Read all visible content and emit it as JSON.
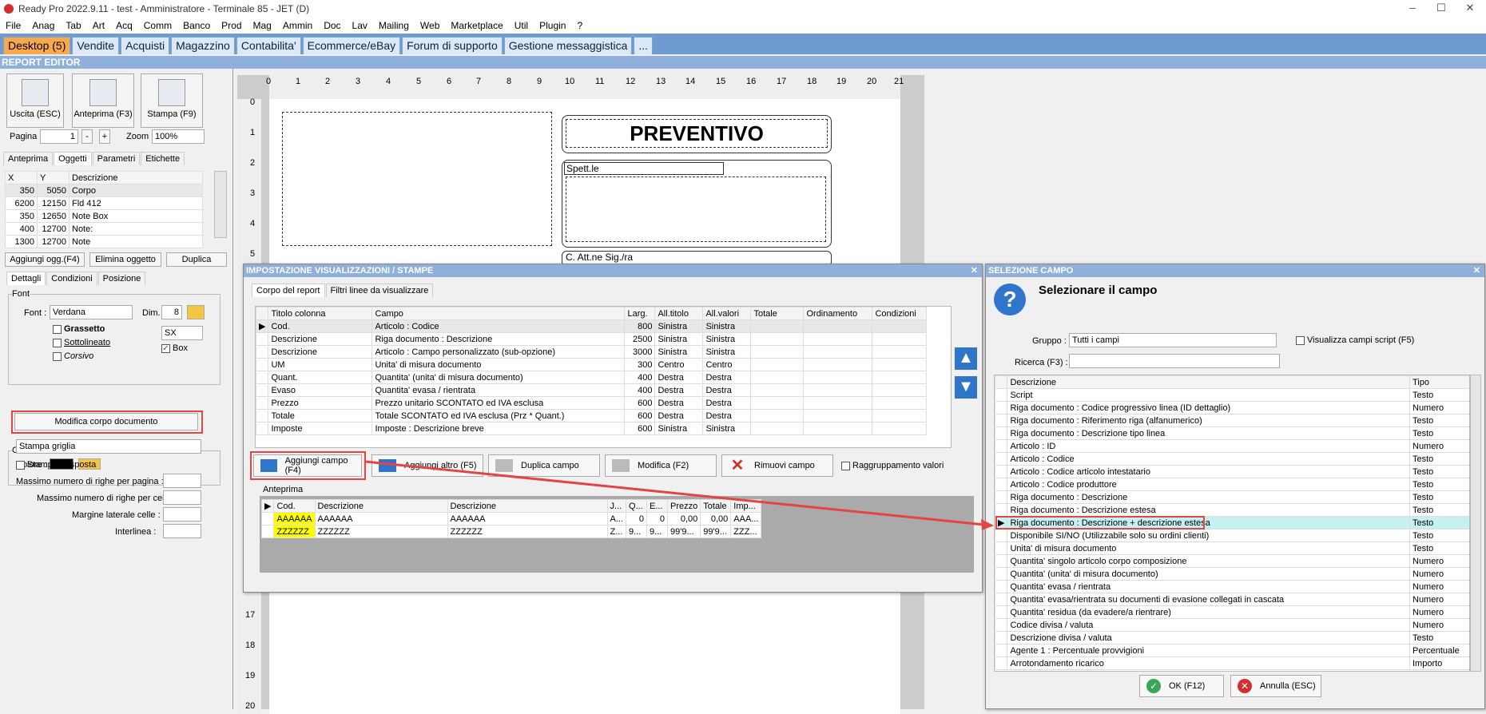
{
  "window": {
    "title": "Ready Pro 2022.9.11 - test - Amministratore - Terminale 85 - JET (D)",
    "min": "–",
    "max": "☐",
    "close": "✕"
  },
  "menu": [
    "File",
    "Anag",
    "Tab",
    "Art",
    "Acq",
    "Comm",
    "Banco",
    "Prod",
    "Mag",
    "Ammin",
    "Doc",
    "Lav",
    "Mailing",
    "Web",
    "Marketplace",
    "Util",
    "Plugin",
    "?"
  ],
  "tabs": [
    "Desktop (5)",
    "Vendite",
    "Acquisti",
    "Magazzino",
    "Contabilita'",
    "Ecommerce/eBay",
    "Forum di supporto",
    "Gestione messaggistica",
    "..."
  ],
  "section_title": "REPORT EDITOR",
  "toolbar": {
    "exit": "Uscita (ESC)",
    "preview": "Anteprima (F3)",
    "print": "Stampa (F9)"
  },
  "paging": {
    "page_label": "Pagina",
    "page_value": "1",
    "minus": "-",
    "plus": "+",
    "zoom_label": "Zoom",
    "zoom_value": "100%"
  },
  "left_tabs": [
    "Anteprima",
    "Oggetti",
    "Parametri",
    "Etichette"
  ],
  "objects_table": {
    "headers": [
      "X",
      "Y",
      "Descrizione"
    ],
    "rows": [
      [
        "350",
        "5050",
        "Corpo"
      ],
      [
        "6200",
        "12150",
        "Fld 412"
      ],
      [
        "350",
        "12650",
        "Note Box"
      ],
      [
        "400",
        "12700",
        "Note:"
      ],
      [
        "1300",
        "12700",
        "Note"
      ]
    ]
  },
  "object_buttons": {
    "add": "Aggiungi ogg.(F4)",
    "delete": "Elimina oggetto",
    "duplicate": "Duplica"
  },
  "detail_tabs": [
    "Dettagli",
    "Condizioni",
    "Posizione"
  ],
  "font_group": {
    "legend": "Font",
    "font_label": "Font :",
    "font_value": "Verdana",
    "dim_label": "Dim.",
    "dim_value": "8",
    "bold": "Grassetto",
    "underline": "Sottolineato",
    "italic": "Corsivo",
    "align_value": "SX",
    "box_label": "Box"
  },
  "color_group": {
    "legend": "Colore",
    "color_label": "Colore :",
    "color_value": "#000000"
  },
  "modify_body_button": "Modifica corpo documento",
  "grid_print": "Stampa griglia",
  "transposed": "Stampa trasposta",
  "max_rows_page": "Massimo numero di righe per pagina :",
  "max_rows_cell": "Massimo numero di righe per cella :",
  "side_margin": "Margine laterale celle :",
  "line_spacing": "Interlinea :",
  "ruler_numbers": [
    "0",
    "1",
    "2",
    "3",
    "4",
    "5",
    "6",
    "7",
    "8",
    "9",
    "10",
    "11",
    "12",
    "13",
    "14",
    "15",
    "16",
    "17",
    "18",
    "19",
    "20",
    "21"
  ],
  "ruler_left_top": [
    "0",
    "1",
    "2",
    "3",
    "4",
    "5"
  ],
  "ruler_left_bottom": [
    "17",
    "18",
    "19",
    "20"
  ],
  "page_content": {
    "title": "PREVENTIVO",
    "spett": "Spett.le",
    "att": "C. Att.ne Sig./ra"
  },
  "dialog1": {
    "title": "IMPOSTAZIONE VISUALIZZAZIONI / STAMPE",
    "tabs": [
      "Corpo del report",
      "Filtri linee da visualizzare"
    ],
    "headers": [
      "Titolo colonna",
      "Campo",
      "Larg.",
      "All.titolo",
      "All.valori",
      "Totale",
      "Ordinamento",
      "Condizioni"
    ],
    "rows": [
      [
        "Cod.",
        "Articolo : Codice",
        "800",
        "Sinistra",
        "Sinistra",
        "",
        "",
        ""
      ],
      [
        "Descrizione",
        "Riga documento : Descrizione",
        "2500",
        "Sinistra",
        "Sinistra",
        "",
        "",
        ""
      ],
      [
        "Descrizione",
        "Articolo : Campo personalizzato (sub-opzione)",
        "3000",
        "Sinistra",
        "Sinistra",
        "",
        "",
        ""
      ],
      [
        "UM",
        "Unita' di misura documento",
        "300",
        "Centro",
        "Centro",
        "",
        "",
        ""
      ],
      [
        "Quant.",
        "Quantita' (unita' di misura documento)",
        "400",
        "Destra",
        "Destra",
        "",
        "",
        ""
      ],
      [
        "Evaso",
        "Quantita' evasa / rientrata",
        "400",
        "Destra",
        "Destra",
        "",
        "",
        ""
      ],
      [
        "Prezzo",
        "Prezzo unitario SCONTATO ed IVA esclusa",
        "600",
        "Destra",
        "Destra",
        "",
        "",
        ""
      ],
      [
        "Totale",
        "Totale SCONTATO ed IVA esclusa (Prz * Quant.)",
        "600",
        "Destra",
        "Destra",
        "",
        "",
        ""
      ],
      [
        "Imposte",
        "Imposte : Descrizione breve",
        "600",
        "Sinistra",
        "Sinistra",
        "",
        "",
        ""
      ]
    ],
    "buttons": {
      "add_field": "Aggiungi campo (F4)",
      "add_other": "Aggiungi altro (F5)",
      "duplicate": "Duplica campo",
      "modify": "Modifica (F2)",
      "remove": "Rimuovi campo"
    },
    "group_values": "Raggruppamento valori",
    "preview_label": "Anteprima",
    "preview_headers": [
      "Cod.",
      "Descrizione",
      "Descrizione",
      "J...",
      "Q...",
      "E...",
      "Prezzo",
      "Totale",
      "Imp..."
    ],
    "preview_rows": [
      [
        "AAAAAA",
        "AAAAAA",
        "AAAAAA",
        "A...",
        "0",
        "0",
        "0,00",
        "0,00",
        "AAA..."
      ],
      [
        "ZZZZZZ",
        "ZZZZZZ",
        "ZZZZZZ",
        "Z...",
        "9...",
        "9...",
        "99'9...",
        "99'9...",
        "ZZZ..."
      ]
    ]
  },
  "dialog2": {
    "title": "SELEZIONE CAMPO",
    "heading": "Selezionare il campo",
    "group_label": "Gruppo :",
    "group_value": "Tutti i campi",
    "script_fields": "Visualizza campi script (F5)",
    "search_label": "Ricerca (F3) :",
    "search_value": "",
    "headers": [
      "Descrizione",
      "Tipo"
    ],
    "rows": [
      [
        "Script",
        "Testo"
      ],
      [
        "Riga documento : Codice progressivo linea (ID dettaglio)",
        "Numero"
      ],
      [
        "Riga documento : Riferimento riga (alfanumerico)",
        "Testo"
      ],
      [
        "Riga documento : Descrizione tipo linea",
        "Testo"
      ],
      [
        "Articolo : ID",
        "Numero"
      ],
      [
        "Articolo : Codice",
        "Testo"
      ],
      [
        "Articolo : Codice articolo intestatario",
        "Testo"
      ],
      [
        "Articolo : Codice produttore",
        "Testo"
      ],
      [
        "Riga documento : Descrizione",
        "Testo"
      ],
      [
        "Riga documento : Descrizione estesa",
        "Testo"
      ],
      [
        "Riga documento : Descrizione + descrizione estesa",
        "Testo"
      ],
      [
        "Disponibile SI/NO (Utilizzabile solo su ordini clienti)",
        "Testo"
      ],
      [
        "Unita' di misura documento",
        "Testo"
      ],
      [
        "Quantita' singolo articolo corpo composizione",
        "Numero"
      ],
      [
        "Quantita' (unita' di misura documento)",
        "Numero"
      ],
      [
        "Quantita' evasa / rientrata",
        "Numero"
      ],
      [
        "Quantita' evasa/rientrata su documenti di evasione collegati in cascata",
        "Numero"
      ],
      [
        "Quantita' residua (da evadere/a rientrare)",
        "Numero"
      ],
      [
        "Codice divisa / valuta",
        "Numero"
      ],
      [
        "Descrizione divisa / valuta",
        "Testo"
      ],
      [
        "Agente 1 : Percentuale provvigioni",
        "Percentuale"
      ],
      [
        "Arrotondamento ricarico",
        "Importo"
      ]
    ],
    "selected_index": 10,
    "ok": "OK (F12)",
    "cancel": "Annulla (ESC)"
  },
  "colors": {
    "accent_tab": "#f7a94b",
    "tabbar": "#6f9bd1",
    "titlebar_blue": "#8eb0da",
    "highlight_red": "#e34545",
    "selected_row": "#c6f0f2",
    "preview_yellow": "#ffff00"
  }
}
